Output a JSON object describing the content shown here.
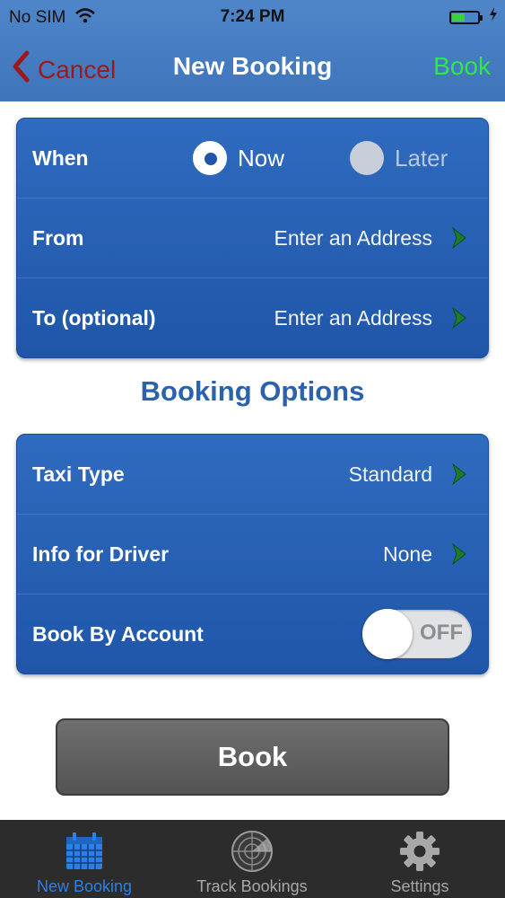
{
  "status_bar": {
    "carrier": "No SIM",
    "time": "7:24 PM",
    "battery_level": 0.45
  },
  "nav": {
    "cancel_label": "Cancel",
    "title": "New Booking",
    "book_label": "Book"
  },
  "trip": {
    "when_label": "When",
    "now_label": "Now",
    "later_label": "Later",
    "selected": "Now",
    "from_label": "From",
    "from_value": "Enter an Address",
    "to_label": "To (optional)",
    "to_value": "Enter an Address"
  },
  "options": {
    "section_title": "Booking Options",
    "taxi_type_label": "Taxi Type",
    "taxi_type_value": "Standard",
    "info_label": "Info for Driver",
    "info_value": "None",
    "account_label": "Book By Account",
    "account_toggle": "OFF"
  },
  "book_button_label": "Book",
  "tabs": [
    {
      "label": "New Booking",
      "icon": "calendar-icon",
      "active": true
    },
    {
      "label": "Track Bookings",
      "icon": "radar-icon",
      "active": false
    },
    {
      "label": "Settings",
      "icon": "gear-icon",
      "active": false
    }
  ],
  "colors": {
    "accent": "#2a80e6",
    "nav_bar": "#4a80c4",
    "cancel": "#a01818",
    "book_nav": "#2ee84a",
    "card": "#2562b4",
    "chevron": "#1a7a2e"
  }
}
